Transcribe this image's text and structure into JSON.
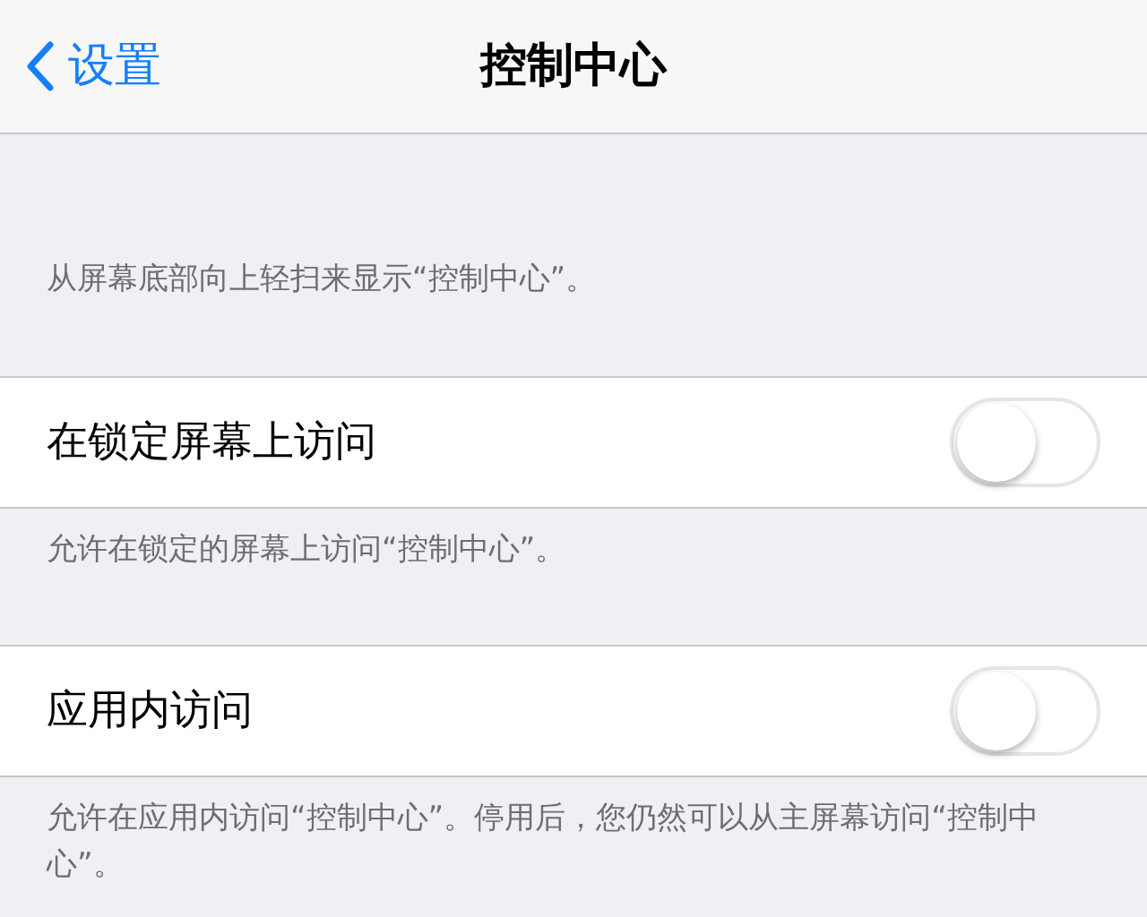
{
  "nav_bar": {
    "back": "设置",
    "title": "控制中心"
  },
  "header_note": "从屏幕底部向上轻扫来显示“控制中心”。",
  "sections": [
    {
      "label": "在锁定屏幕上访问",
      "on": false,
      "footer": "允许在锁定的屏幕上访问“控制中心”。"
    },
    {
      "label": "应用内访问",
      "on": false,
      "footer": "允许在应用内访问“控制中心”。停用后，您仍然可以从主屏幕访问“控制中心”。"
    }
  ]
}
